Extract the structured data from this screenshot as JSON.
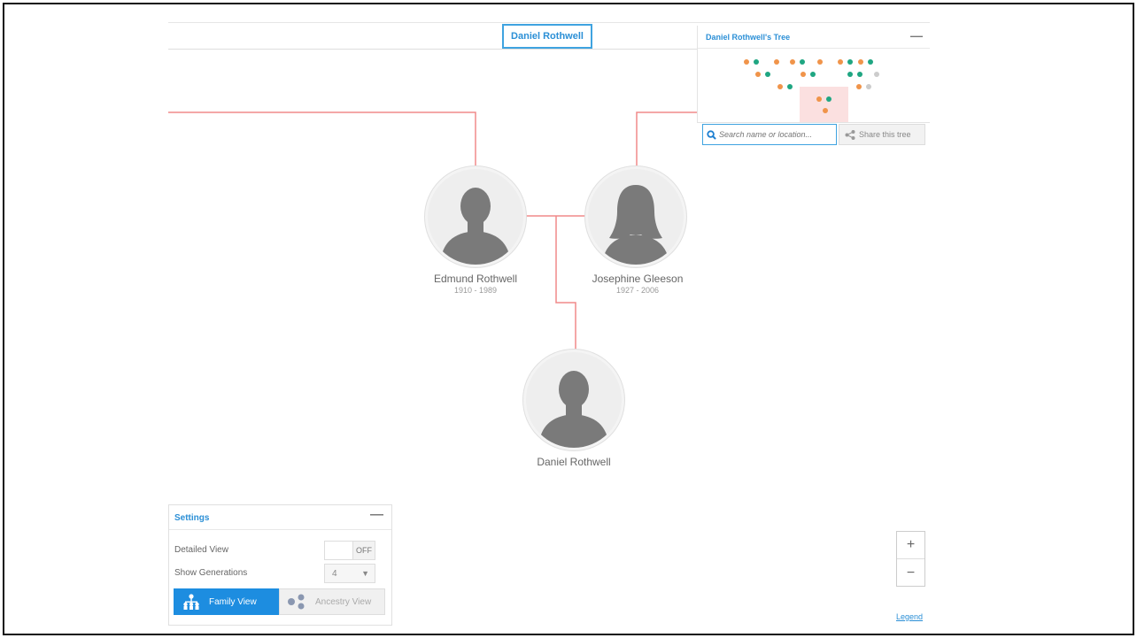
{
  "header": {
    "home_person": "Daniel Rothwell"
  },
  "tree_panel": {
    "title": "Daniel Rothwell's Tree",
    "minimize_symbol": "—",
    "colors": {
      "orange": "#f0944a",
      "green": "#1fa682",
      "gray": "#cccccc",
      "highlight": "#fbe0e0"
    }
  },
  "search": {
    "placeholder": "Search name or location..."
  },
  "share": {
    "label": "Share this tree"
  },
  "people": {
    "father": {
      "name": "Edmund Rothwell",
      "dates": "1910 - 1989"
    },
    "mother": {
      "name": "Josephine Gleeson",
      "dates": "1927 - 2006"
    },
    "child": {
      "name": "Daniel Rothwell"
    }
  },
  "connector_color": "#f08a8a",
  "settings": {
    "title": "Settings",
    "minimize_symbol": "—",
    "detailed_view_label": "Detailed View",
    "detailed_view_state": "OFF",
    "show_generations_label": "Show Generations",
    "generations_value": "4",
    "family_view_label": "Family View",
    "ancestry_view_label": "Ancestry View"
  },
  "zoom": {
    "in": "+",
    "out": "−"
  },
  "legend": {
    "label": "Legend"
  },
  "icons": [
    "search-icon",
    "share-icon",
    "family-view-icon",
    "ancestry-view-icon",
    "dropdown-arrow-icon",
    "male-silhouette-icon",
    "female-silhouette-icon"
  ]
}
